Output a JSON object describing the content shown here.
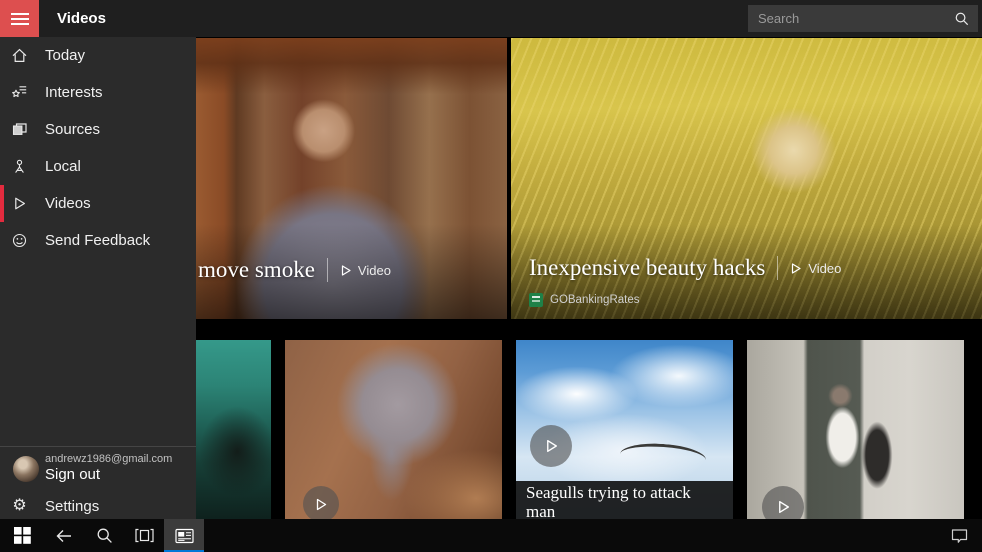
{
  "titlebar": {
    "app_title": "Videos",
    "search_placeholder": "Search"
  },
  "sidebar": {
    "items": [
      {
        "label": "Today",
        "icon": "home-icon",
        "selected": false
      },
      {
        "label": "Interests",
        "icon": "interests-icon",
        "selected": false
      },
      {
        "label": "Sources",
        "icon": "sources-icon",
        "selected": false
      },
      {
        "label": "Local",
        "icon": "local-icon",
        "selected": false
      },
      {
        "label": "Videos",
        "icon": "play-icon",
        "selected": true
      },
      {
        "label": "Send Feedback",
        "icon": "feedback-smiley-icon",
        "selected": false
      }
    ],
    "account": {
      "email": "andrewz1986@gmail.com",
      "sign_out_label": "Sign out"
    },
    "settings_label": "Settings",
    "settings_gear": "⚙"
  },
  "content": {
    "featured": [
      {
        "title": "move smoke",
        "type_label": "Video",
        "thumbnail": "man-with-glasses-indoors"
      },
      {
        "title": "Inexpensive beauty hacks",
        "type_label": "Video",
        "source": "GOBankingRates",
        "thumbnail": "blonde-woman-yellow"
      }
    ],
    "thumbnails": [
      {
        "thumbnail": "shark-in-teal-water",
        "title": ""
      },
      {
        "thumbnail": "baby-elephant-in-sand",
        "title": ""
      },
      {
        "thumbnail": "seagull-in-cloudy-sky",
        "title": "Seagulls trying to attack man"
      },
      {
        "thumbnail": "two-men-in-room",
        "title": ""
      }
    ]
  },
  "colors": {
    "accent_red": "#dd4f4f",
    "selection_red": "#e32b3e",
    "taskbar_underline": "#0078d7",
    "source_logo_green": "#1e8148",
    "titlebar_bg": "#1f1f1f",
    "sidebar_bg": "#2b2b2b",
    "taskbar_bg": "#0a0a0a"
  }
}
